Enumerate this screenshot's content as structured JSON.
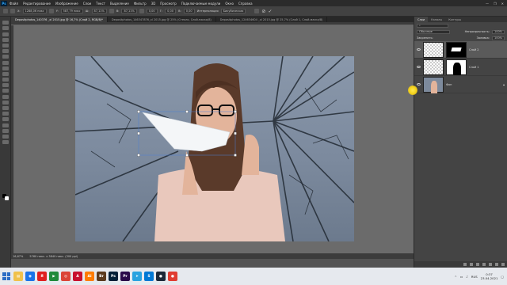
{
  "app": {
    "logo": "Ps"
  },
  "menu": [
    "Файл",
    "Редактирование",
    "Изображение",
    "Слои",
    "Текст",
    "Выделение",
    "Фильтр",
    "3D",
    "Просмотр",
    "Подключаемые модули",
    "Окно",
    "Справка"
  ],
  "window_controls": [
    "—",
    "❐",
    "✕"
  ],
  "options": {
    "x_value": "1288,06 пикс",
    "y_value": "587,79 пикс",
    "w_value": "87,11%",
    "h_value": "87,11%",
    "angle_value": "0,00",
    "skew_h": "0,00",
    "skew_v": "0,00",
    "interp_label": "Интерполяция",
    "interp_value": "Бикубическая"
  },
  "tabs": [
    {
      "label": "Depositphotos_140376 _xl 2015.jpg @ 16,7% (Слой 2, RGB/8)*",
      "active": true
    },
    {
      "label": "Depositphotos_146347876_xl 2015.jpg @ 25% (Стекло, Слой-маска/8)",
      "active": false
    },
    {
      "label": "Depositphotos_124634604 _xl 2015.jpg @ 25,7% (Слой 1, Слой-маска/8)",
      "active": false
    }
  ],
  "statusbar": {
    "zoom": "16,67%",
    "doc": "5760 пикс. x 3840 пикс. (300 ppi)"
  },
  "panel": {
    "tabs": [
      "Слои",
      "Каналы",
      "Контуры"
    ],
    "blend_mode": "Обычные",
    "opacity_label": "Непрозрачность:",
    "opacity_value": "100%",
    "lock_label": "Закрепить:",
    "fill_label": "Заливка:",
    "fill_value": "100%",
    "layers": [
      {
        "name": "Слой 2",
        "selected": true
      },
      {
        "name": "Слой 1",
        "selected": false
      },
      {
        "name": "Фон",
        "selected": false
      }
    ]
  },
  "taskbar": {
    "apps": [
      {
        "icon": "explorer-icon",
        "label": "▤",
        "color": "#f0c14b"
      },
      {
        "icon": "browser-icon",
        "label": "◉",
        "color": "#1a73e8"
      },
      {
        "icon": "yandex-icon",
        "label": "Я",
        "color": "#e02020"
      },
      {
        "icon": "media-icon",
        "label": "▶",
        "color": "#1f8a3a"
      },
      {
        "icon": "chrome-icon",
        "label": "◎",
        "color": "#db4437"
      },
      {
        "icon": "acrobat-icon",
        "label": "A",
        "color": "#c8102e"
      },
      {
        "icon": "illustrator-icon",
        "label": "Ai",
        "color": "#ff7c00"
      },
      {
        "icon": "bridge-icon",
        "label": "Br",
        "color": "#5b3a1e"
      },
      {
        "icon": "photoshop-icon",
        "label": "Ps",
        "color": "#001e36"
      },
      {
        "icon": "premiere-icon",
        "label": "Pr",
        "color": "#2a0a4a"
      },
      {
        "icon": "telegram-icon",
        "label": "➤",
        "color": "#2aa3e0"
      },
      {
        "icon": "skype-icon",
        "label": "S",
        "color": "#0078d4"
      },
      {
        "icon": "steam-icon",
        "label": "●",
        "color": "#1b2838"
      },
      {
        "icon": "recorder-icon",
        "label": "●",
        "color": "#e03c31"
      }
    ],
    "time": "0:37",
    "date": "23.04.2021",
    "lang": "RUS"
  }
}
